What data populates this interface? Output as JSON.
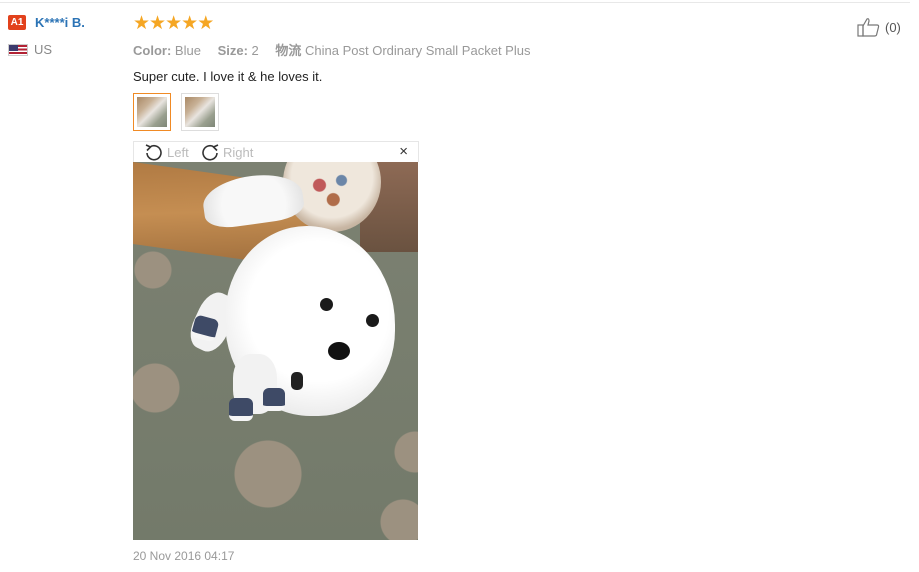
{
  "user": {
    "level": "A1",
    "name": "K****i B.",
    "country": "US"
  },
  "review": {
    "rating": 5,
    "color_label": "Color:",
    "color_value": "Blue",
    "size_label": "Size:",
    "size_value": "2",
    "shipping_label": "物流",
    "shipping_value": "China Post Ordinary Small Packet Plus",
    "text": "Super cute. I love it & he loves it.",
    "timestamp": "20 Nov 2016 04:17"
  },
  "viewer": {
    "rotate_left": "Left",
    "rotate_right": "Right",
    "close": "×"
  },
  "helpful": {
    "count": "(0)"
  },
  "colors": {
    "star": "#f5a623",
    "badge": "#e2411c",
    "username": "#2b73b5",
    "active_thumb": "#f08a24"
  }
}
